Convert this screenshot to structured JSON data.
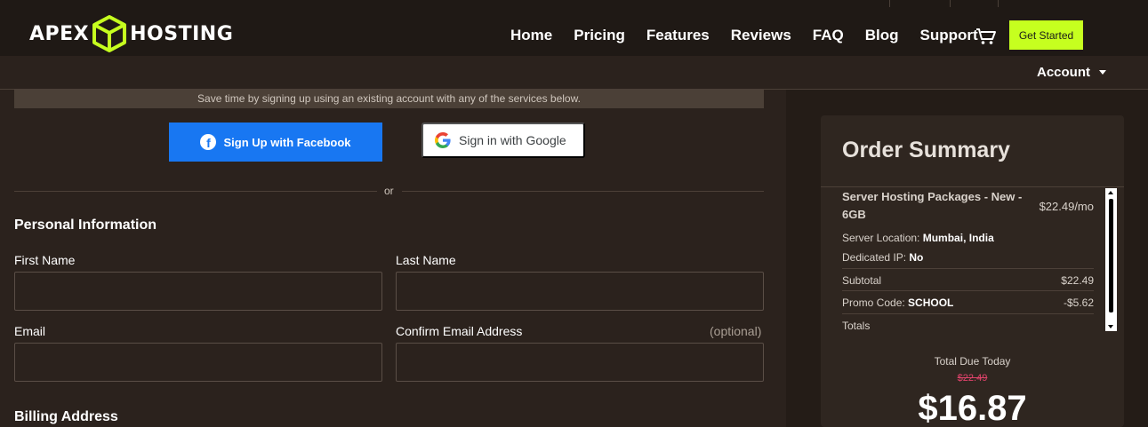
{
  "brand": {
    "left_text": "APEX",
    "right_text": "HOSTING",
    "cube_color": "#c6ff1f"
  },
  "nav": {
    "items": [
      "Home",
      "Pricing",
      "Features",
      "Reviews",
      "FAQ",
      "Blog",
      "Support"
    ],
    "cart_icon": "cart-icon",
    "cta_label": "Get Started",
    "cta_color": "#c6ff1f"
  },
  "account": {
    "label": "Account"
  },
  "social": {
    "note": "Save time by signing up using an existing account with any of the services below.",
    "facebook_label": "Sign Up with Facebook",
    "facebook_color": "#1877f2",
    "google_label": "Sign in with Google",
    "or_text": "or"
  },
  "personal": {
    "title": "Personal Information",
    "first_name_label": "First Name",
    "last_name_label": "Last Name",
    "email_label": "Email",
    "confirm_email_label": "Confirm Email Address",
    "optional_text": "(optional)"
  },
  "billing": {
    "title": "Billing Address"
  },
  "summary": {
    "title": "Order Summary",
    "item_name": "Server Hosting Packages - New - 6GB",
    "item_price": "$22.49/mo",
    "location_label": "Server Location:",
    "location_value": "Mumbai, India",
    "dedicated_ip_label": "Dedicated IP:",
    "dedicated_ip_value": "No",
    "subtotal_label": "Subtotal",
    "subtotal_value": "$22.49",
    "promo_label": "Promo Code:",
    "promo_code": "SCHOOL",
    "promo_value": "-$5.62",
    "totals_label": "Totals",
    "total_due_label": "Total Due Today",
    "old_price": "$22.49",
    "old_price_color": "#e0436b",
    "total_price": "$16.87"
  }
}
